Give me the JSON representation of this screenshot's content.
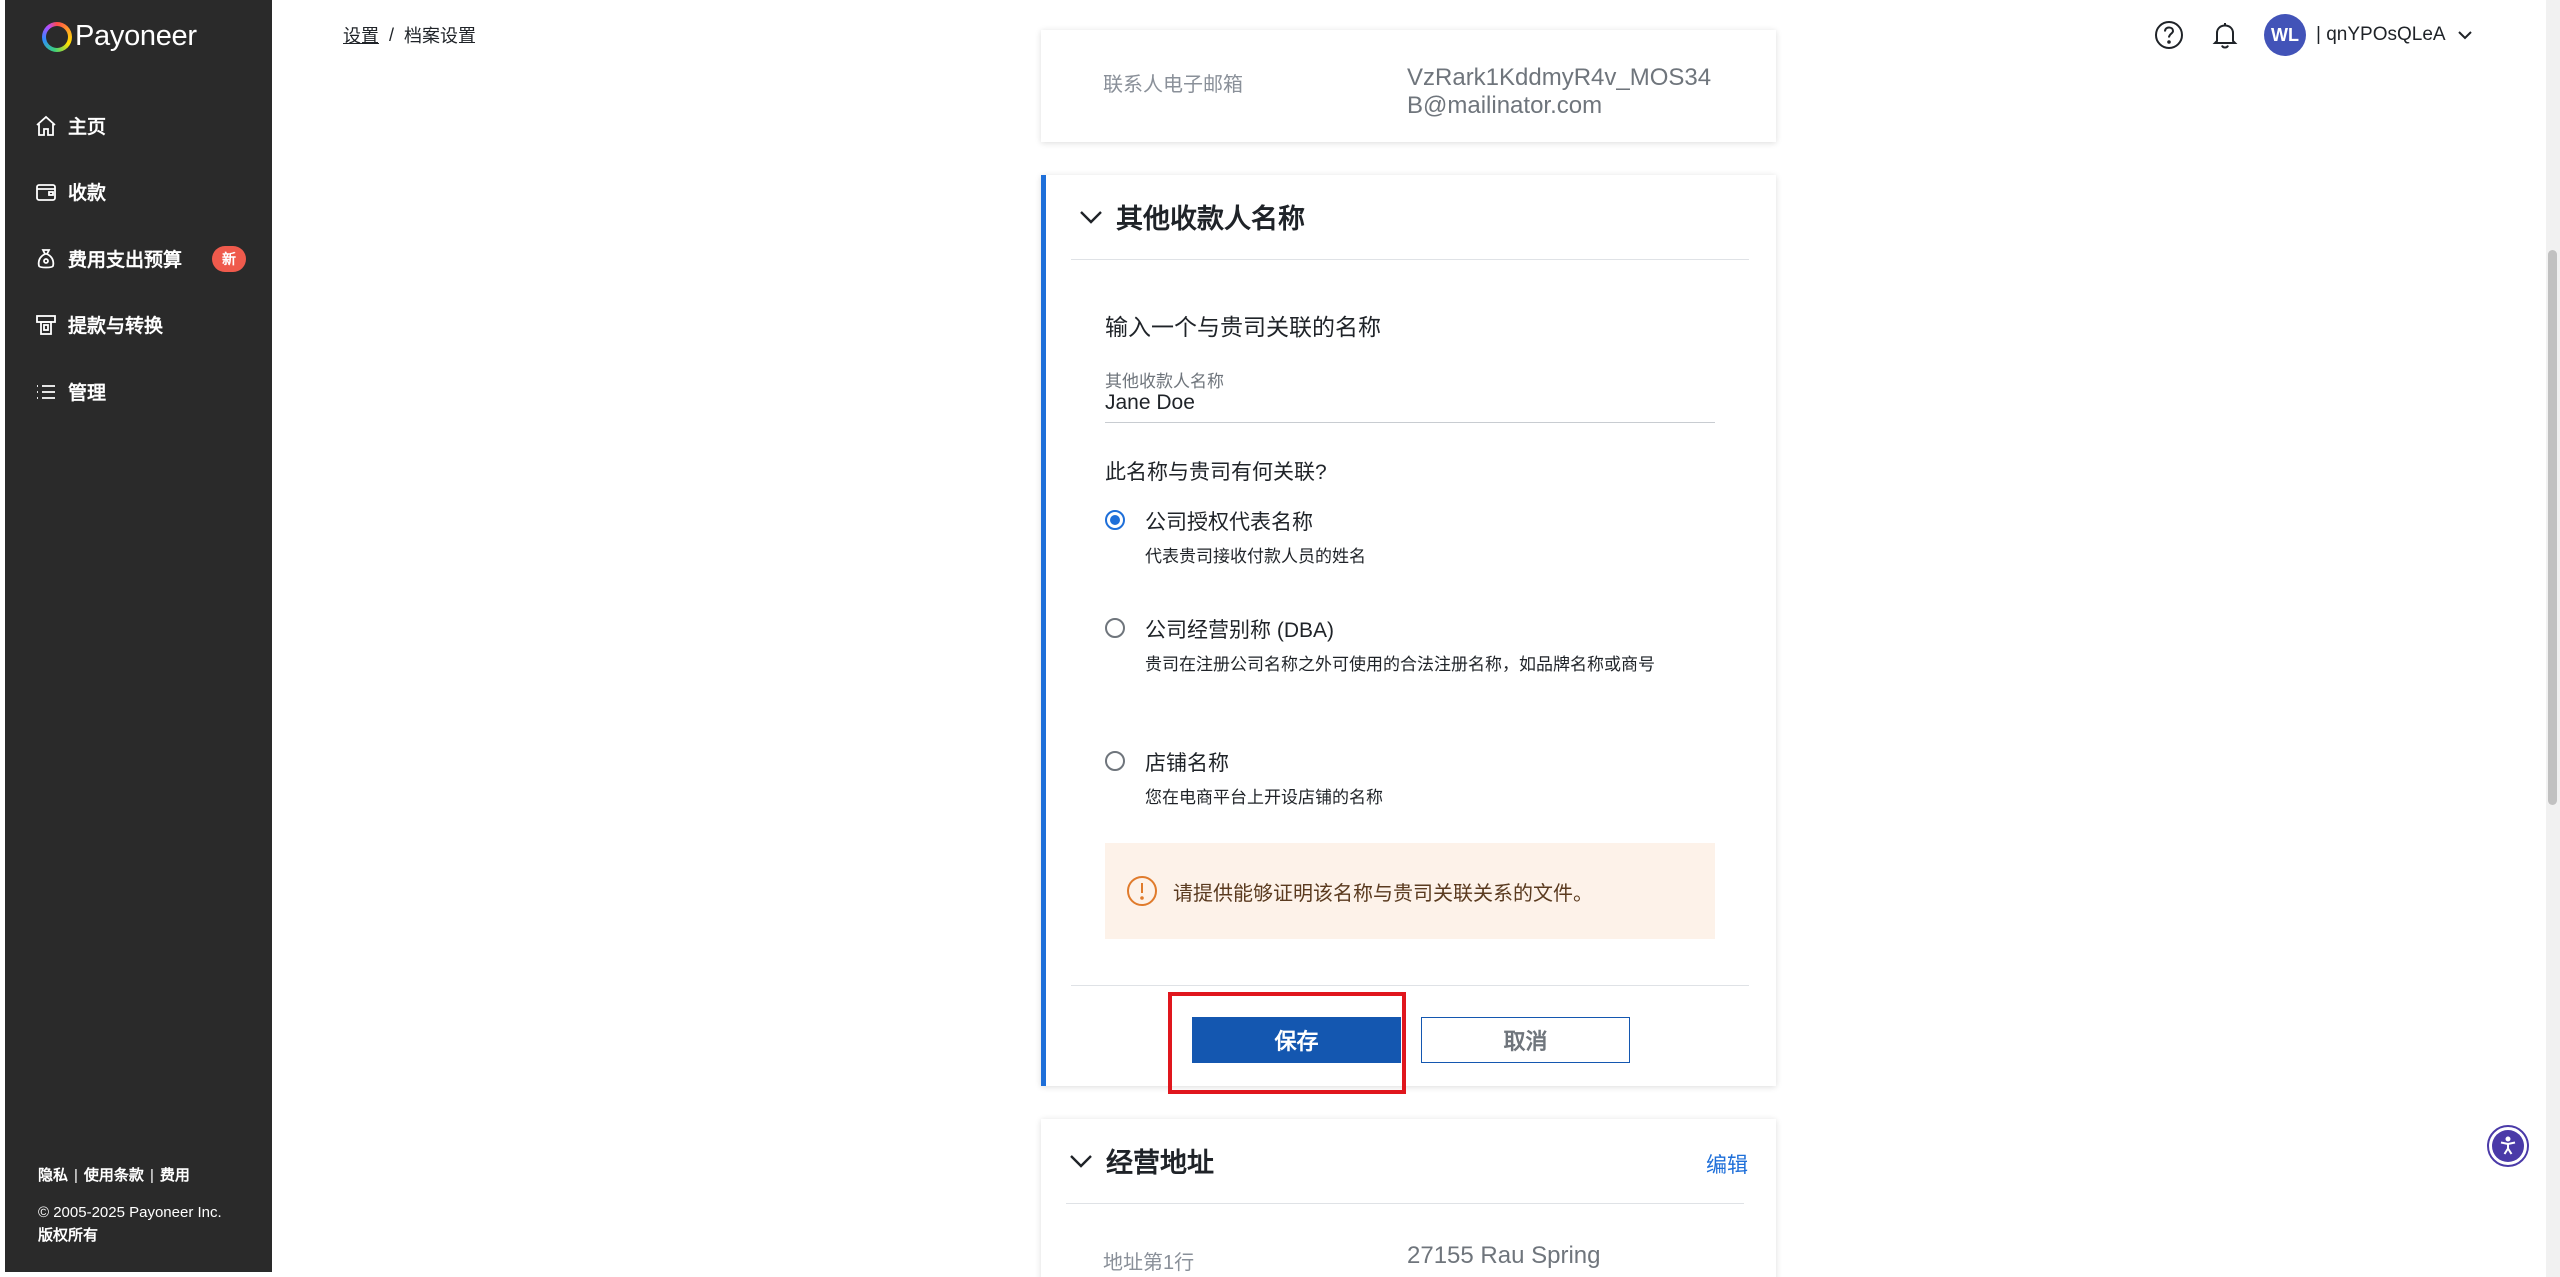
{
  "sidebar": {
    "logo_text": "Payoneer",
    "items": [
      {
        "label": "主页",
        "icon": "home-icon"
      },
      {
        "label": "收款",
        "icon": "wallet-icon"
      },
      {
        "label": "费用支出预算",
        "icon": "money-bag-icon",
        "badge": "新"
      },
      {
        "label": "提款与转换",
        "icon": "withdraw-icon"
      },
      {
        "label": "管理",
        "icon": "list-icon"
      }
    ],
    "footer": {
      "links": [
        "隐私",
        "使用条款",
        "费用"
      ],
      "separator": "|",
      "copyright": "© 2005-2025 Payoneer Inc.",
      "rights": "版权所有"
    }
  },
  "header": {
    "breadcrumb": {
      "parent": "设置",
      "separator": "/",
      "current": "档案设置"
    },
    "avatar_initials": "WL",
    "user_name": "| qnYPOsQLeA"
  },
  "contact_card": {
    "label": "联系人电子邮箱",
    "value": "VzRark1KddmyR4v_MOS34B@mailinator.com"
  },
  "other_payee": {
    "title": "其他收款人名称",
    "prompt": "输入一个与贵司关联的名称",
    "field_label": "其他收款人名称",
    "field_value": "Jane Doe",
    "question": "此名称与贵司有何关联?",
    "options": [
      {
        "title": "公司授权代表名称",
        "desc": "代表贵司接收付款人员的姓名",
        "checked": true
      },
      {
        "title": "公司经营别称 (DBA)",
        "desc": "贵司在注册公司名称之外可使用的合法注册名称，如品牌名称或商号",
        "checked": false
      },
      {
        "title": "店铺名称",
        "desc": "您在电商平台上开设店铺的名称",
        "checked": false
      }
    ],
    "notice": "请提供能够证明该名称与贵司关联关系的文件。",
    "save_label": "保存",
    "cancel_label": "取消"
  },
  "business_address": {
    "title": "经营地址",
    "edit_label": "编辑",
    "line1_label": "地址第1行",
    "line1_value": "27155 Rau Spring"
  },
  "colors": {
    "sidebar_bg": "#2a2a2a",
    "accent": "#1e6fd9",
    "save_button": "#1457b0",
    "badge": "#ef5a4c",
    "notice_bg": "#fdf2e9",
    "highlight": "#e0161d"
  }
}
